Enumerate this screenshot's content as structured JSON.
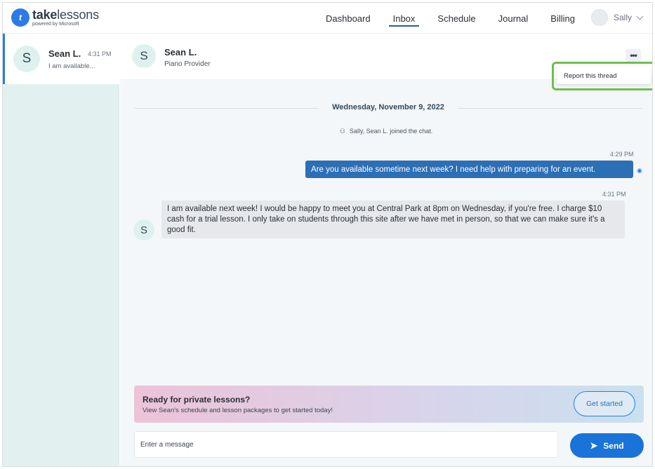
{
  "brand": {
    "name_bold": "take",
    "name_rest": "lessons",
    "sub": "powered by Microsoft"
  },
  "nav": {
    "items": [
      {
        "label": "Dashboard"
      },
      {
        "label": "Inbox"
      },
      {
        "label": "Schedule"
      },
      {
        "label": "Journal"
      },
      {
        "label": "Billing"
      }
    ],
    "active": "Inbox",
    "user_name": "Sally"
  },
  "sidebar": {
    "threads": [
      {
        "initial": "S",
        "name": "Sean L.",
        "time": "4:31 PM",
        "preview": "I am available..."
      }
    ]
  },
  "chat": {
    "contact_initial": "S",
    "contact_name": "Sean L.",
    "contact_role": "Piano Provider",
    "more_label": "•••",
    "menu_item": "Report this thread",
    "date": "Wednesday, November 9, 2022",
    "join_note": "Sally, Sean L. joined the chat.",
    "messages": [
      {
        "direction": "out",
        "time": "4:29 PM",
        "text": "Are you available sometime next week? I need help with preparing for an event."
      },
      {
        "direction": "in",
        "time": "4:31 PM",
        "initial": "S",
        "text": "I am available next week! I would be happy to meet you at Central Park at 8pm on Wednesday, if you're free. I charge $10 cash for a trial lesson. I only take on students through this site after we have met in person, so that we can make sure it's a good fit."
      }
    ]
  },
  "promo": {
    "title": "Ready for private lessons?",
    "subtitle": "View Sean's schedule and lesson packages to get started today!",
    "button": "Get started"
  },
  "composer": {
    "placeholder": "Enter a message",
    "send_label": "Send"
  },
  "colors": {
    "accent": "#2c7be5",
    "outgoing_bubble": "#2c6fb5",
    "highlight": "#6cc04a"
  }
}
